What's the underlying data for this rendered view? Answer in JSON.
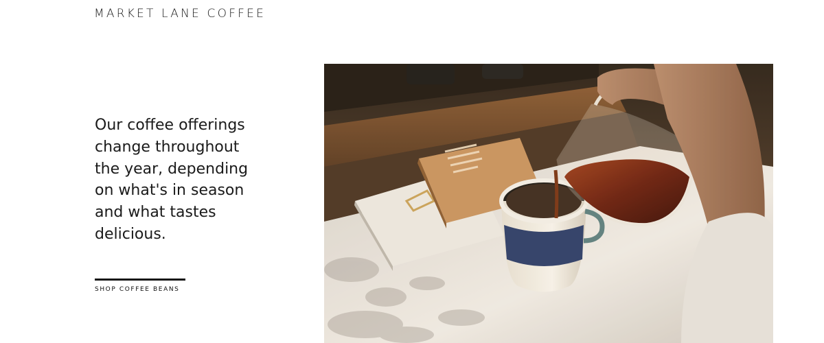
{
  "header": {
    "brand": "MARKET LANE COFFEE"
  },
  "hero": {
    "body_text": "Our coffee offerings change throughout the year, depending on what's in season and what tastes delicious.",
    "cta_label": "SHOP COFFEE BEANS"
  }
}
